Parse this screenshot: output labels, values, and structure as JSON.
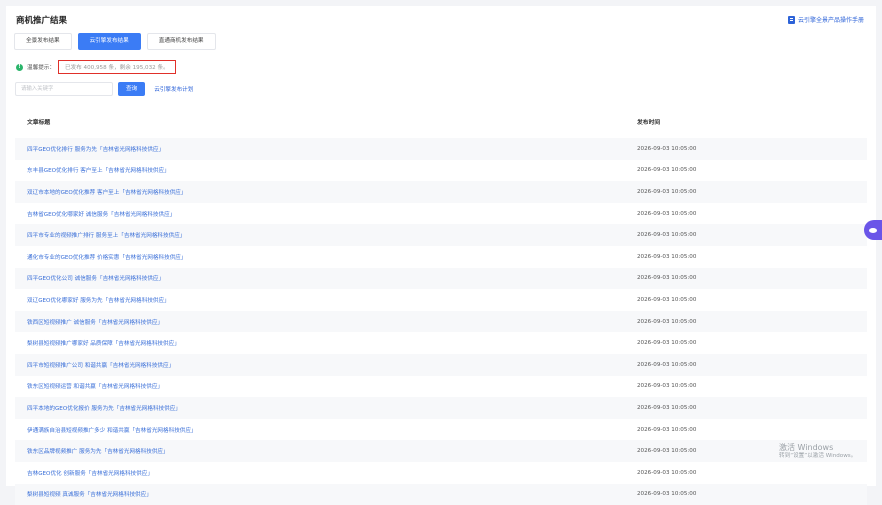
{
  "page": {
    "title": "商机推广结果",
    "manual_link": "云引擎全景产品操作手册"
  },
  "tabs": [
    {
      "label": "全景发布结果",
      "active": false
    },
    {
      "label": "云引擎发布结果",
      "active": true
    },
    {
      "label": "直通商机发布结果",
      "active": false
    }
  ],
  "tip": {
    "label": "温馨提示：",
    "text": "已发布 400,958 条，剩余 195,032 条。"
  },
  "search": {
    "placeholder": "请输入关键字",
    "button": "查询",
    "plan_link": "云引擎发布计划"
  },
  "table": {
    "columns": [
      "文章标题",
      "发布时间"
    ],
    "rows": [
      {
        "title": "四平GEO优化排行 服务为先「吉林省光网格科技供应」",
        "time": "2026-09-03 10:05:00"
      },
      {
        "title": "东丰县GEO优化排行 客户至上「吉林省光网格科技供应」",
        "time": "2026-09-03 10:05:00"
      },
      {
        "title": "双辽市本地的GEO优化推荐 客户至上「吉林省光网格科技供应」",
        "time": "2026-09-03 10:05:00"
      },
      {
        "title": "吉林省GEO优化哪家好 诚信服务「吉林省光网格科技供应」",
        "time": "2026-09-03 10:05:00"
      },
      {
        "title": "四平市专业的视频推广排行 服务至上「吉林省光网格科技供应」",
        "time": "2026-09-03 10:05:00"
      },
      {
        "title": "通化市专业的GEO优化推荐 价格实惠「吉林省光网格科技供应」",
        "time": "2026-09-03 10:05:00"
      },
      {
        "title": "四平GEO优化公司 诚信服务「吉林省光网格科技供应」",
        "time": "2026-09-03 10:05:00"
      },
      {
        "title": "双辽GEO优化哪家好 服务为先「吉林省光网格科技供应」",
        "time": "2026-09-03 10:05:00"
      },
      {
        "title": "铁西区短视频推广 诚信服务「吉林省光网格科技供应」",
        "time": "2026-09-03 10:05:00"
      },
      {
        "title": "梨树县短视频推广哪家好 品质保障「吉林省光网格科技供应」",
        "time": "2026-09-03 10:05:00"
      },
      {
        "title": "四平市短视频推广公司 和谐共赢「吉林省光网格科技供应」",
        "time": "2026-09-03 10:05:00"
      },
      {
        "title": "铁东区短视频运营 和谐共赢「吉林省光网格科技供应」",
        "time": "2026-09-03 10:05:00"
      },
      {
        "title": "四平本地的GEO优化报价 服务为先「吉林省光网格科技供应」",
        "time": "2026-09-03 10:05:00"
      },
      {
        "title": "伊通满族自治县短视频推广多少 和谐共赢「吉林省光网格科技供应」",
        "time": "2026-09-03 10:05:00"
      },
      {
        "title": "铁东区品牌视频推广 服务为先「吉林省光网格科技供应」",
        "time": "2026-09-03 10:05:00"
      },
      {
        "title": "吉林GEO优化 创新服务「吉林省光网格科技供应」",
        "time": "2026-09-03 10:05:00"
      },
      {
        "title": "梨树县短视频 真诚服务「吉林省光网格科技供应」",
        "time": "2026-09-03 10:05:00"
      }
    ]
  },
  "watermark": {
    "line1": "激活 Windows",
    "line2": "转到“设置”以激活 Windows。"
  }
}
